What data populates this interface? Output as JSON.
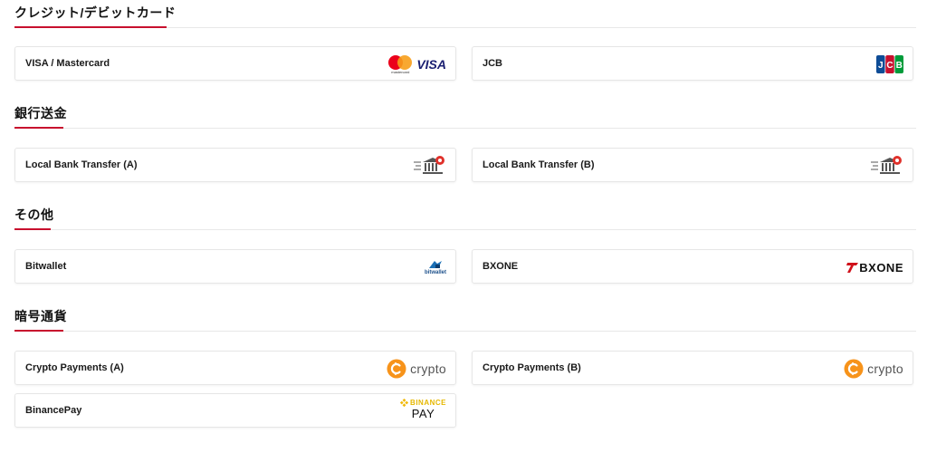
{
  "sections": [
    {
      "title": "クレジット/デビットカード",
      "items": [
        {
          "label": "VISA / Mastercard",
          "logo": "visa-mastercard",
          "logo_text": "VISA",
          "logo_subtext": "mastercard"
        },
        {
          "label": "JCB",
          "logo": "jcb",
          "logo_text": "JCB"
        }
      ]
    },
    {
      "title": "銀行送金",
      "items": [
        {
          "label": "Local Bank Transfer (A)",
          "logo": "bank-transfer-icon"
        },
        {
          "label": "Local Bank Transfer (B)",
          "logo": "bank-transfer-icon"
        }
      ]
    },
    {
      "title": "その他",
      "items": [
        {
          "label": "Bitwallet",
          "logo": "bitwallet",
          "logo_text": "bitwallet"
        },
        {
          "label": "BXONE",
          "logo": "bxone",
          "logo_text": "BXONE"
        }
      ]
    },
    {
      "title": "暗号通貨",
      "items": [
        {
          "label": "Crypto Payments (A)",
          "logo": "crypto",
          "logo_text": "crypto"
        },
        {
          "label": "Crypto Payments (B)",
          "logo": "crypto",
          "logo_text": "crypto"
        },
        {
          "label": "BinancePay",
          "logo": "binance-pay",
          "logo_text": "BINANCE",
          "logo_subtext": "PAY"
        }
      ]
    }
  ],
  "colors": {
    "accent": "#c8102e",
    "crypto": "#f7931a",
    "binance": "#f0b90b",
    "visa": "#1a1f71",
    "mastercard_red": "#eb001b",
    "mastercard_orange": "#f79e1b"
  }
}
